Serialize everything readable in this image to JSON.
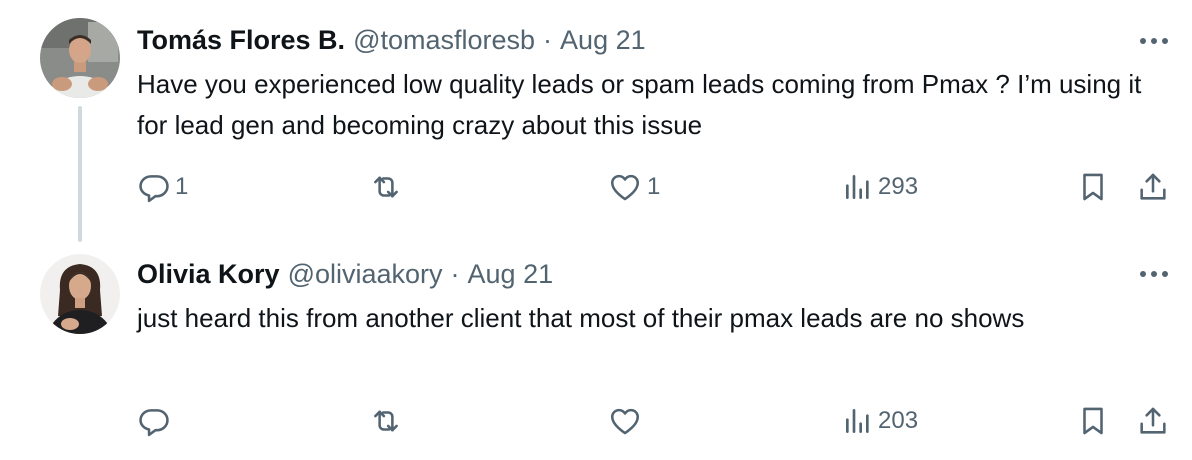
{
  "tweets": [
    {
      "author": {
        "name": "Tomás Flores B.",
        "handle": "@tomasfloresb"
      },
      "separator": "·",
      "date": "Aug 21",
      "text": "Have you experienced low quality leads or spam leads coming from Pmax ? I’m using it for lead gen and becoming crazy about this issue",
      "metrics": {
        "replies": "1",
        "reposts": "",
        "likes": "1",
        "views": "293"
      }
    },
    {
      "author": {
        "name": "Olivia Kory",
        "handle": "@oliviaakory"
      },
      "separator": "·",
      "date": "Aug 21",
      "text": "just heard this from another client that most of their pmax leads are no shows",
      "metrics": {
        "replies": "",
        "reposts": "",
        "likes": "",
        "views": "203"
      }
    }
  ],
  "icons": {
    "more": "more-horizontal-icon",
    "reply": "reply-icon",
    "repost": "repost-icon",
    "like": "heart-icon",
    "views": "analytics-icon",
    "bookmark": "bookmark-icon",
    "share": "share-icon"
  },
  "colors": {
    "text": "#0f1419",
    "secondary": "#536471",
    "thread_line": "#cfd9de",
    "background": "#ffffff"
  }
}
